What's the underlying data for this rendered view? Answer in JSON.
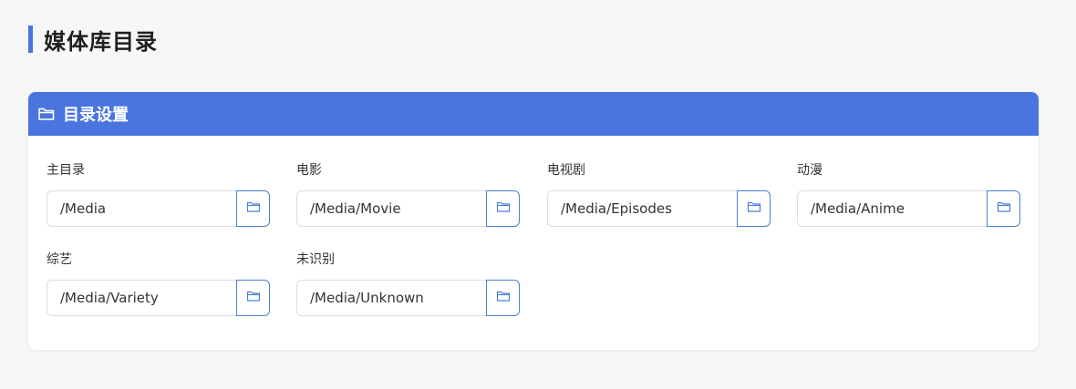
{
  "page": {
    "title": "媒体库目录"
  },
  "card": {
    "title": "目录设置",
    "header_icon": "folder-icon",
    "accent_color": "#4a74de"
  },
  "fields": [
    {
      "label": "主目录",
      "value": "/Media"
    },
    {
      "label": "电影",
      "value": "/Media/Movie"
    },
    {
      "label": "电视剧",
      "value": "/Media/Episodes"
    },
    {
      "label": "动漫",
      "value": "/Media/Anime"
    },
    {
      "label": "综艺",
      "value": "/Media/Variety"
    },
    {
      "label": "未识别",
      "value": "/Media/Unknown"
    }
  ]
}
